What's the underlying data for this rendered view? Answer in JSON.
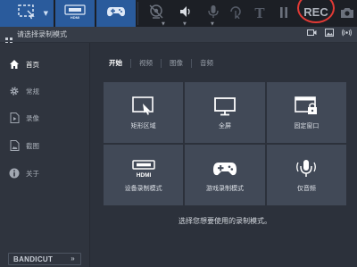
{
  "toolbar": {
    "mode_buttons": [
      {
        "name": "rectangle-mode",
        "icon": "screen-area-icon"
      },
      {
        "name": "hdmi-mode",
        "icon": "hdmi-icon",
        "label": "HDMI"
      },
      {
        "name": "game-mode",
        "icon": "gamepad-icon"
      }
    ],
    "text_tool": "T",
    "rec_label": "REC"
  },
  "title_bar": {
    "title": "请选择录制模式",
    "icons": [
      "video-icon",
      "image-icon",
      "audio-wave-icon"
    ]
  },
  "sidebar": {
    "items": [
      {
        "label": "首页",
        "icon": "home-icon",
        "active": true
      },
      {
        "label": "常规",
        "icon": "gear-icon",
        "active": false
      },
      {
        "label": "录像",
        "icon": "video-file-icon",
        "active": false
      },
      {
        "label": "截图",
        "icon": "image-file-icon",
        "active": false
      },
      {
        "label": "关于",
        "icon": "info-icon",
        "active": false
      }
    ],
    "logo": "BANDICUT",
    "logo_arrows": "»"
  },
  "main": {
    "tabs": [
      "开始",
      "视频",
      "图像",
      "音频"
    ],
    "tiles": [
      {
        "label": "矩形区域",
        "icon": "rectangle-area-icon"
      },
      {
        "label": "全屏",
        "icon": "monitor-icon"
      },
      {
        "label": "固定窗口",
        "icon": "lock-window-icon"
      },
      {
        "label": "设备录制模式",
        "icon": "hdmi-device-icon",
        "icon_text": "HDMI"
      },
      {
        "label": "游戏录制模式",
        "icon": "gamepad-icon"
      },
      {
        "label": "仅音频",
        "icon": "microphone-icon"
      }
    ],
    "hint": "选择您想要使用的录制模式。"
  },
  "colors": {
    "accent_blue": "#2a5b9c",
    "rec_ring": "#e23a35",
    "background": "#2c313b",
    "tile": "#414957"
  }
}
